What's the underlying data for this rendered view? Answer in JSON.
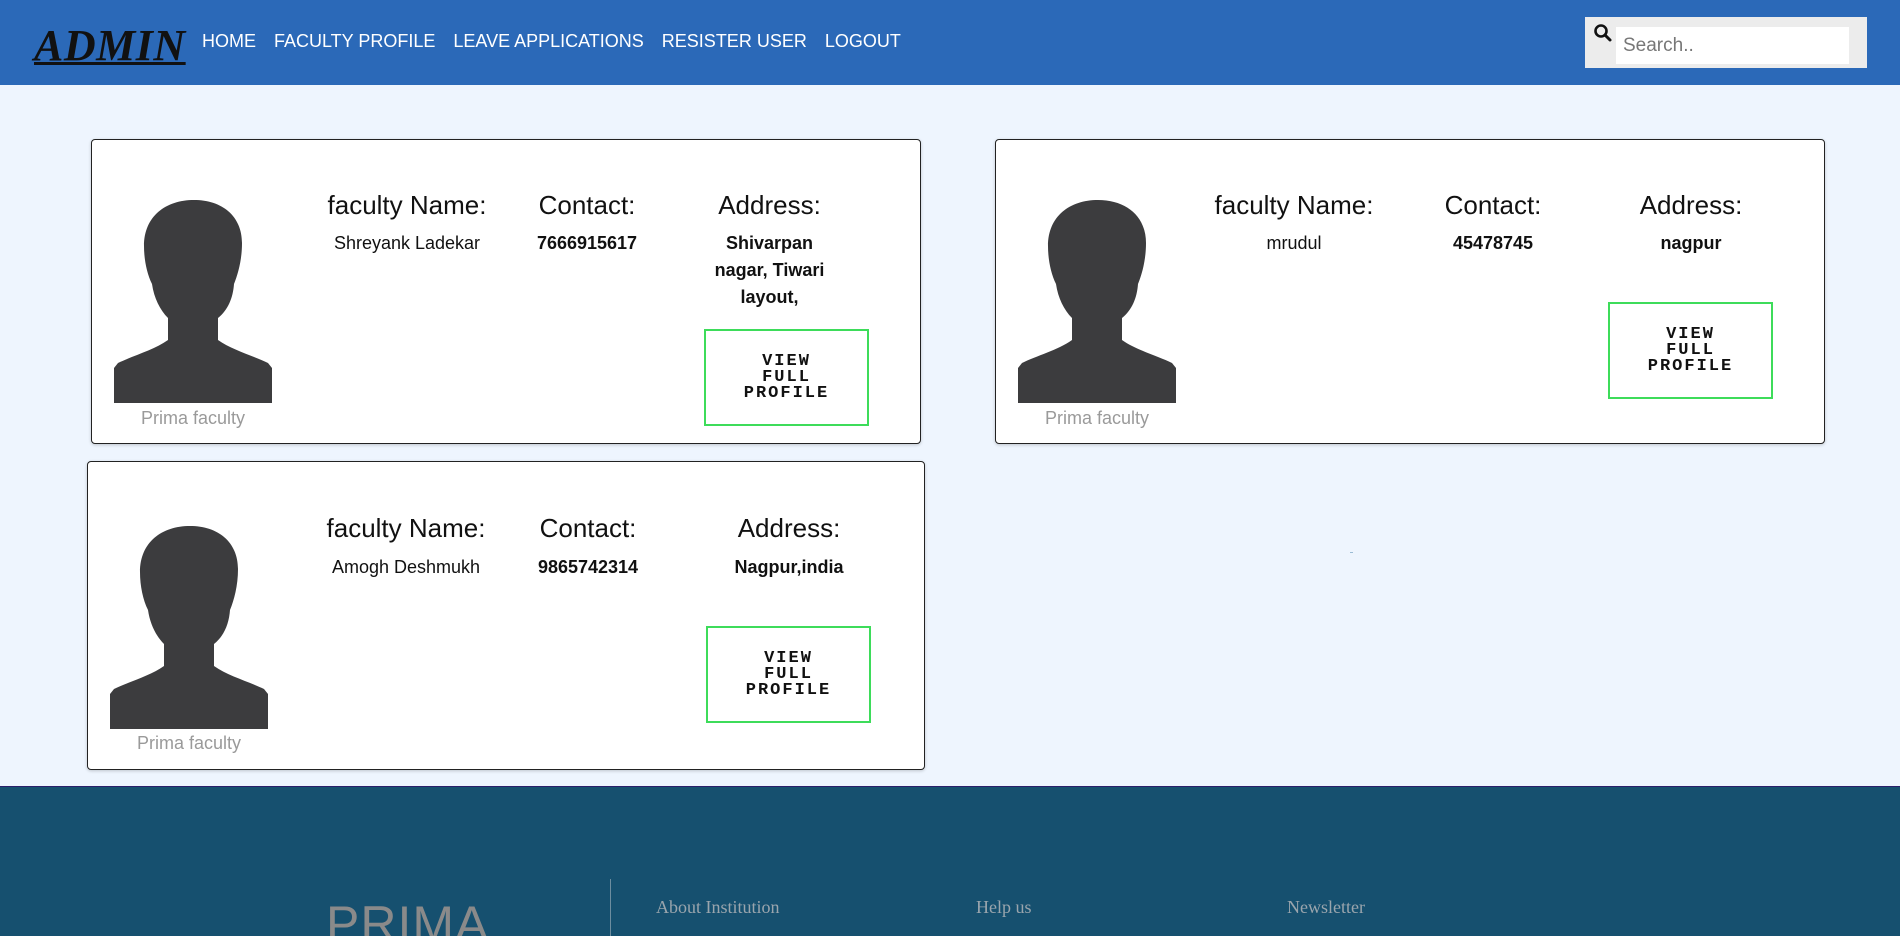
{
  "nav": {
    "brand": "ADMIN",
    "links": [
      "HOME",
      "FACULTY PROFILE",
      "LEAVE APPLICATIONS",
      "RESISTER USER",
      "LOGOUT"
    ],
    "search_placeholder": "Search.."
  },
  "cards": [
    {
      "caption": "Prima faculty",
      "name_label": "faculty Name:",
      "contact_label": "Contact:",
      "address_label": "Address:",
      "name": "Shreyank Ladekar",
      "contact": "7666915617",
      "address": "Shivarpan nagar, Tiwari layout,",
      "button": "VIEW FULL PROFILE"
    },
    {
      "caption": "Prima faculty",
      "name_label": "faculty Name:",
      "contact_label": "Contact:",
      "address_label": "Address:",
      "name": "mrudul",
      "contact": "45478745",
      "address": "nagpur",
      "button": "VIEW FULL PROFILE"
    },
    {
      "caption": "Prima faculty",
      "name_label": "faculty Name:",
      "contact_label": "Contact:",
      "address_label": "Address:",
      "name": "Amogh Deshmukh",
      "contact": "9865742314",
      "address": "Nagpur,india",
      "button": "VIEW FULL PROFILE"
    }
  ],
  "footer": {
    "logo": "PRIMA",
    "links": [
      "About Institution",
      "Help us",
      "Newsletter"
    ]
  },
  "colors": {
    "navbar": "#2b69b8",
    "page_bg": "#eef5fe",
    "footer": "#16506f",
    "button_border": "#3ddc5a"
  }
}
